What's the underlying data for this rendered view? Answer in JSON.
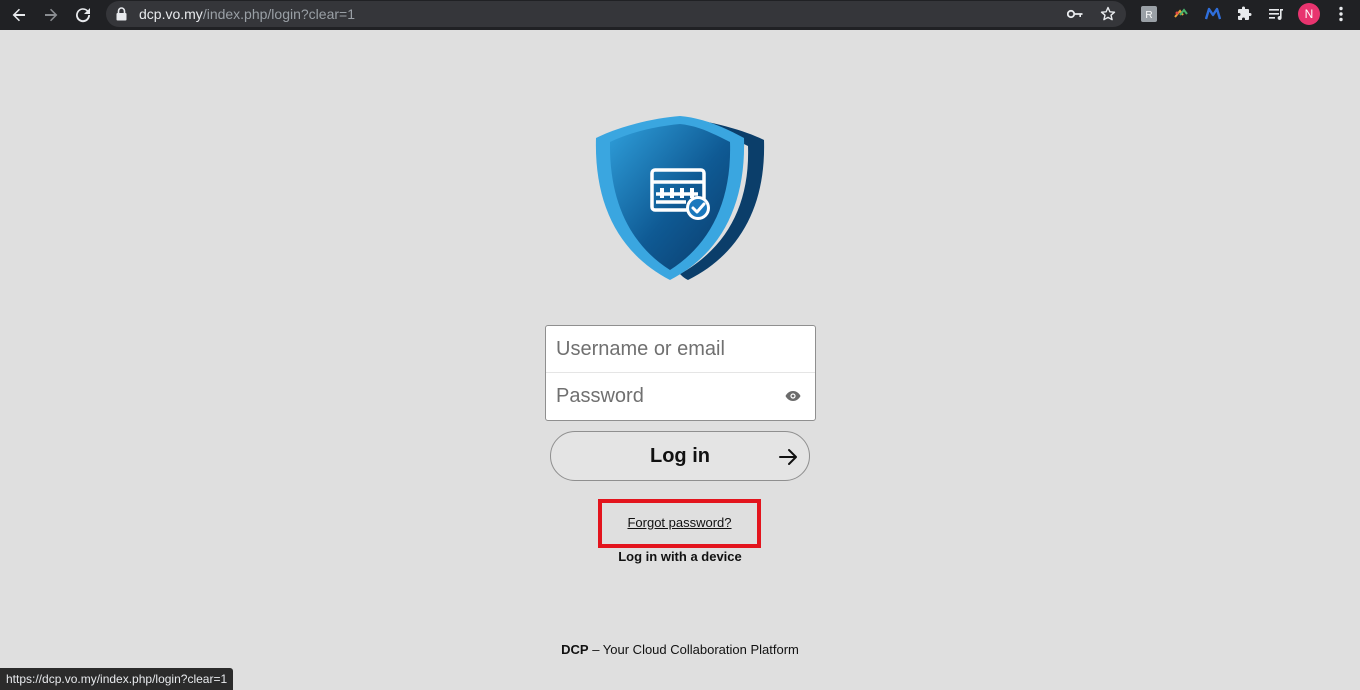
{
  "browser": {
    "url_host": "dcp.vo.my",
    "url_path": "/index.php/login?clear=1",
    "profile_initial": "N",
    "icons": [
      "back-icon",
      "forward-icon",
      "reload-icon",
      "lock-icon",
      "key-icon",
      "star-icon",
      "extension-icon",
      "puzzle-icon",
      "media-icon",
      "menu-icon"
    ]
  },
  "login": {
    "username_placeholder": "Username or email",
    "password_placeholder": "Password",
    "login_label": "Log in",
    "forgot_label": "Forgot password?",
    "device_label": "Log in with a device"
  },
  "footer": {
    "brand": "DCP",
    "tagline": " – Your Cloud Collaboration Platform"
  },
  "status_bar": {
    "url": "https://dcp.vo.my/index.php/login?clear=1"
  },
  "colors": {
    "highlight": "#e3141d",
    "shield_light": "#3aa6e0",
    "shield_dark": "#0b3e6a"
  }
}
